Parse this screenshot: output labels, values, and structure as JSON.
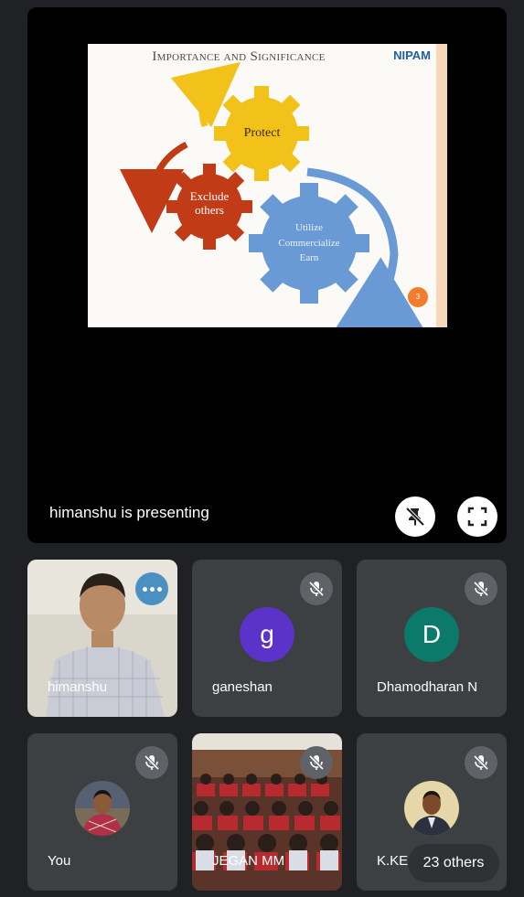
{
  "presentation": {
    "slide_title": "Importance and Significance",
    "logo_text": "NIPAM",
    "gear_labels": {
      "protect": "Protect",
      "exclude_line1": "Exclude",
      "exclude_line2": "others",
      "utilize_line1": "Utilize",
      "utilize_line2": "Commercialize",
      "utilize_line3": "Earn"
    },
    "page_number": "3",
    "presenting_label": "himanshu is presenting"
  },
  "participants": [
    {
      "name": "himanshu",
      "status": "speaking"
    },
    {
      "name": "ganeshan",
      "avatar_letter": "g",
      "avatar_color": "#5b33c9",
      "muted": true
    },
    {
      "name": "Dhamodharan N",
      "avatar_letter": "D",
      "avatar_color": "#0c7a6a",
      "muted": true
    },
    {
      "name": "You",
      "muted": true
    },
    {
      "name": "JEGAN MM",
      "muted": true
    },
    {
      "name": "K.KESAVARAJ",
      "muted": true
    }
  ],
  "others_count_label": "23 others",
  "icons": [
    "unpin-icon",
    "fullscreen-icon",
    "mic-off-icon",
    "more-options-icon"
  ],
  "colors": {
    "background": "#202124",
    "tile": "#3c4043",
    "gear_yellow": "#f2c21a",
    "gear_red": "#c13b16",
    "gear_blue": "#6a9ad6"
  }
}
